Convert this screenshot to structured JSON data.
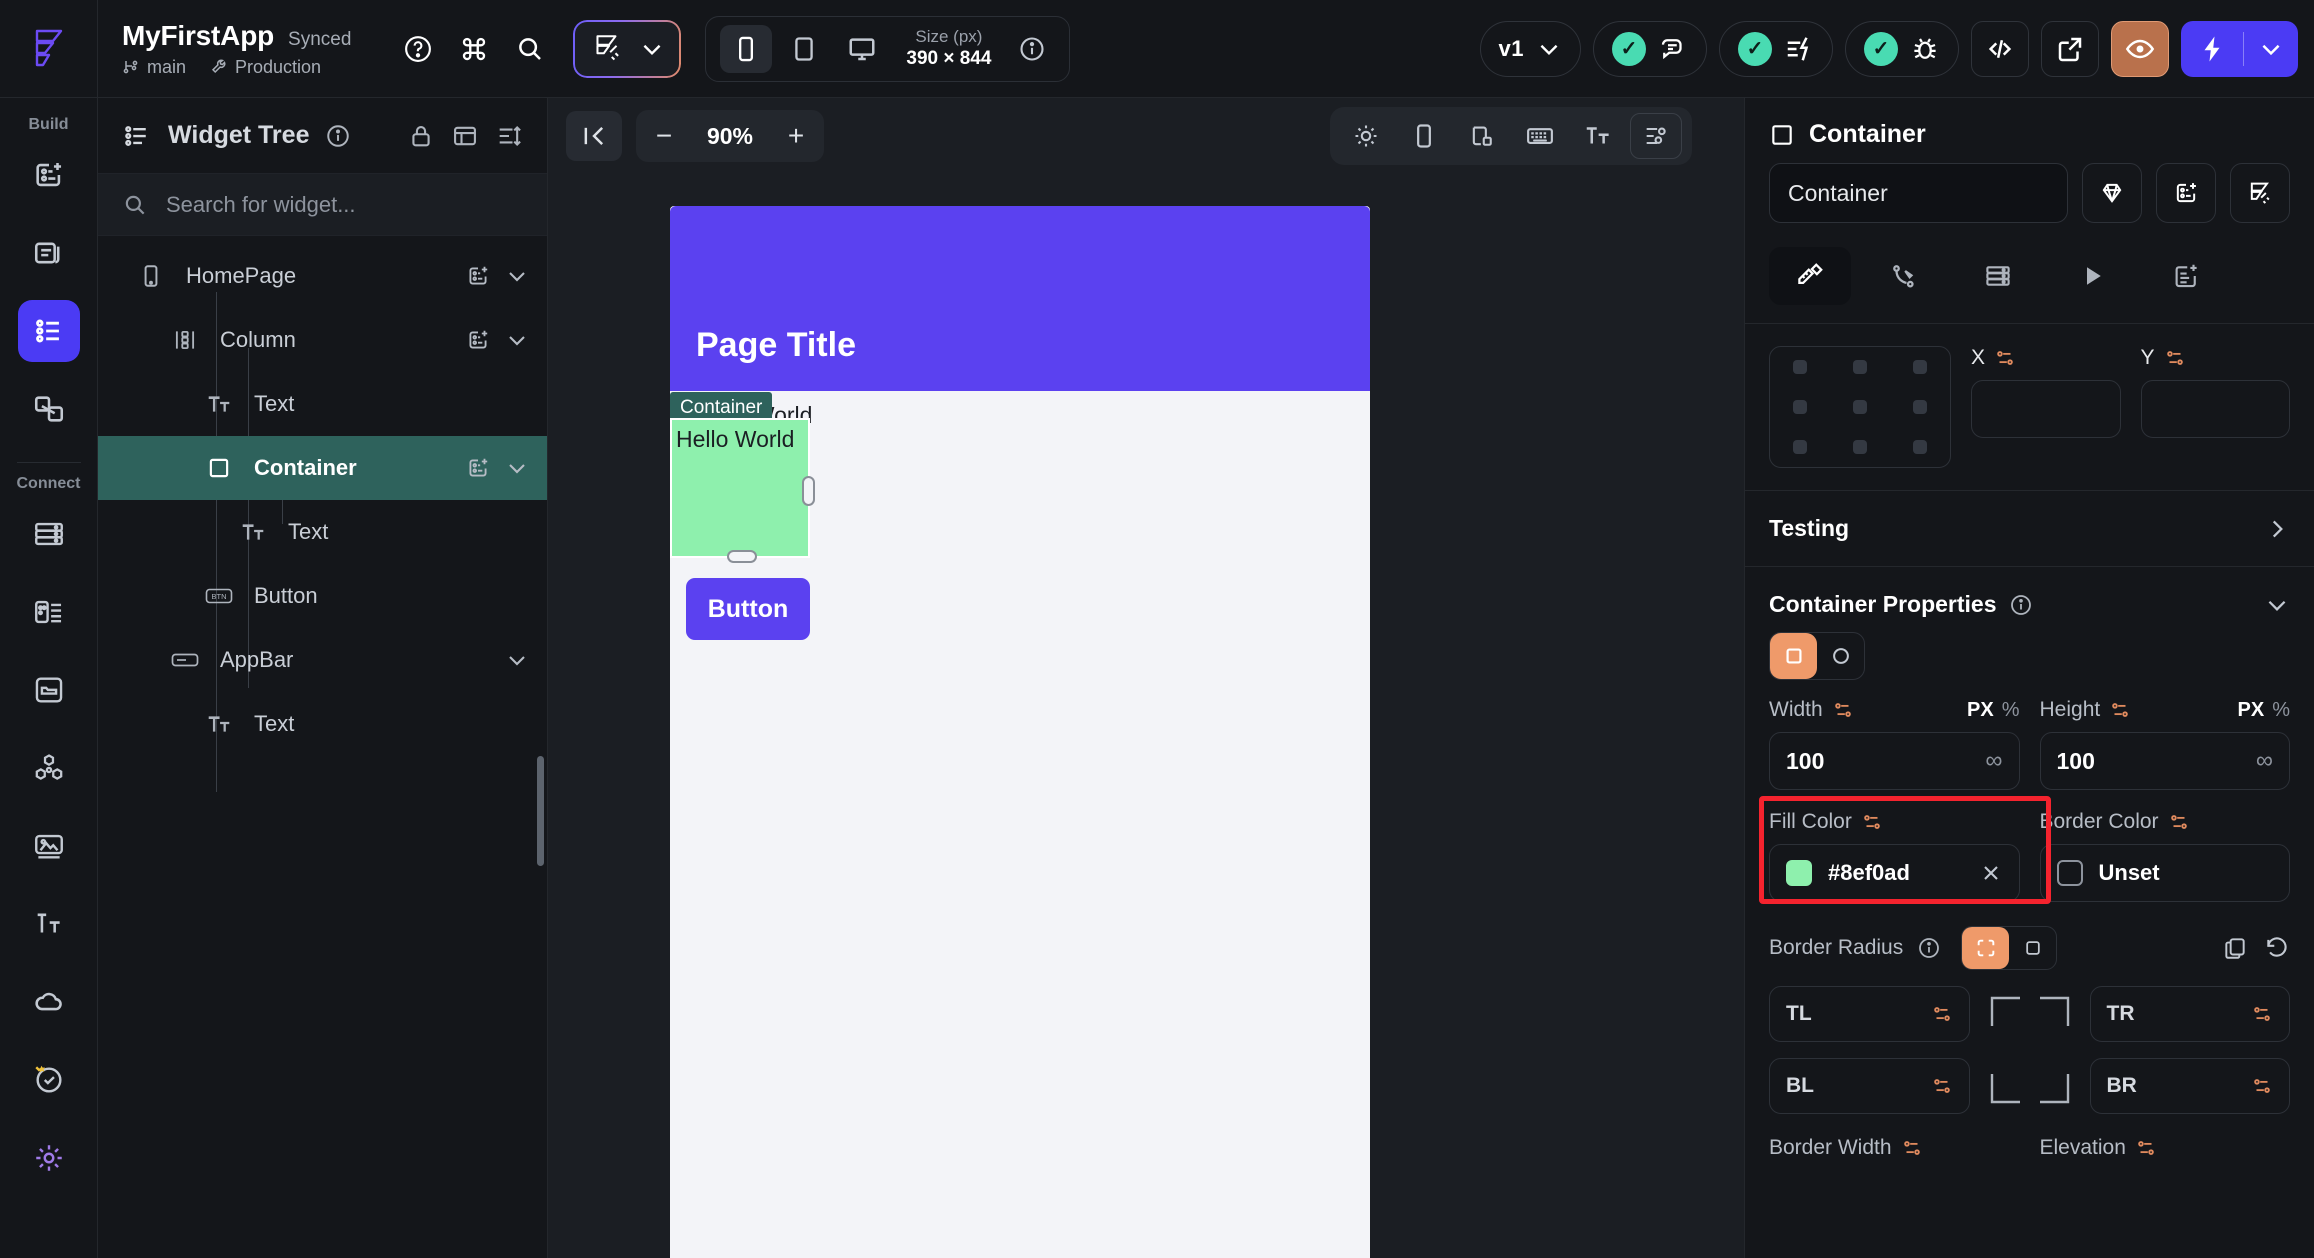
{
  "topbar": {
    "app_name": "MyFirstApp",
    "sync_status": "Synced",
    "branch": "main",
    "environment": "Production",
    "icons": [
      "help-icon",
      "command-icon",
      "search-icon"
    ],
    "ai_button": "flutterflow-ai-icon",
    "devices": [
      "phone-icon",
      "tablet-icon",
      "desktop-icon"
    ],
    "size_label": "Size (px)",
    "size_value": "390 × 844",
    "version": "v1",
    "right_icons": [
      "comment-icon",
      "actions-icon",
      "bug-icon",
      "code-icon",
      "share-icon",
      "eye-icon",
      "run-icon"
    ],
    "accent_purple": "#4b3bf4",
    "accent_orange": "#b9714c",
    "accent_teal": "#49dbb2"
  },
  "rail": {
    "build_label": "Build",
    "connect_label": "Connect",
    "items": [
      {
        "name": "add-page-icon",
        "active": false
      },
      {
        "name": "components-icon",
        "active": false
      },
      {
        "name": "widget-tree-icon",
        "active": true
      },
      {
        "name": "navigation-icon",
        "active": false
      },
      {
        "name": "database-icon",
        "active": false
      },
      {
        "name": "app-state-icon",
        "active": false
      },
      {
        "name": "assets-folder-icon",
        "active": false
      },
      {
        "name": "integrations-icon",
        "active": false
      },
      {
        "name": "media-icon",
        "active": false
      },
      {
        "name": "text-styles-icon",
        "active": false
      },
      {
        "name": "cloud-icon",
        "active": false
      },
      {
        "name": "favorites-icon",
        "active": false
      },
      {
        "name": "settings-icon",
        "active": false
      }
    ]
  },
  "tree": {
    "title": "Widget Tree",
    "search_placeholder": "Search for widget...",
    "items": [
      {
        "label": "HomePage",
        "icon": "page-icon",
        "depth": 0,
        "selected": false,
        "has_add": true,
        "has_chevron": true
      },
      {
        "label": "Column",
        "icon": "column-icon",
        "depth": 1,
        "selected": false,
        "has_add": true,
        "has_chevron": true
      },
      {
        "label": "Text",
        "icon": "text-icon",
        "depth": 2,
        "selected": false,
        "has_add": false,
        "has_chevron": false
      },
      {
        "label": "Container",
        "icon": "container-icon",
        "depth": 2,
        "selected": true,
        "has_add": true,
        "has_chevron": true
      },
      {
        "label": "Text",
        "icon": "text-icon",
        "depth": 3,
        "selected": false,
        "has_add": false,
        "has_chevron": false
      },
      {
        "label": "Button",
        "icon": "button-icon",
        "depth": 2,
        "selected": false,
        "has_add": false,
        "has_chevron": false
      },
      {
        "label": "AppBar",
        "icon": "appbar-icon",
        "depth": 1,
        "selected": false,
        "has_add": false,
        "has_chevron": true
      },
      {
        "label": "Text",
        "icon": "text-icon",
        "depth": 2,
        "selected": false,
        "has_add": false,
        "has_chevron": false
      }
    ]
  },
  "canvas": {
    "zoom": "90%",
    "zoom_out": "−",
    "zoom_in": "+",
    "collapse_icon": "collapse-panel-icon",
    "tools": [
      "theme-icon",
      "device-preview-icon",
      "responsive-icon",
      "keyboard-icon",
      "text-scale-icon",
      "settings-sliders-icon"
    ],
    "page_title": "Page Title",
    "hello_world_behind": "Hello World",
    "selection_tag": "Container",
    "container_text": "Hello World",
    "button_label": "Button",
    "appbar_color": "#5b41f0",
    "container_color": "#8ef0ad"
  },
  "props": {
    "header_title": "Container",
    "name_value": "Container",
    "header_icons": [
      "theme-widget-icon",
      "add-widget-icon",
      "ai-widget-icon"
    ],
    "tabs": [
      "properties-icon",
      "actions-icon",
      "backend-icon",
      "animations-icon",
      "notes-icon"
    ],
    "x_label": "X",
    "y_label": "Y",
    "testing_label": "Testing",
    "container_properties_label": "Container Properties",
    "shape_square": "square-icon",
    "shape_circle": "circle-icon",
    "width_label": "Width",
    "width_value": "100",
    "height_label": "Height",
    "height_value": "100",
    "unit_px": "PX",
    "unit_percent": "%",
    "infinity": "∞",
    "fill_color_label": "Fill Color",
    "fill_color_value": "#8ef0ad",
    "border_color_label": "Border Color",
    "border_color_value": "Unset",
    "border_radius_label": "Border Radius",
    "corner_tl": "TL",
    "corner_tr": "TR",
    "corner_bl": "BL",
    "corner_br": "BR",
    "border_width_label": "Border Width",
    "elevation_label": "Elevation",
    "highlight_color": "#f5232e"
  }
}
